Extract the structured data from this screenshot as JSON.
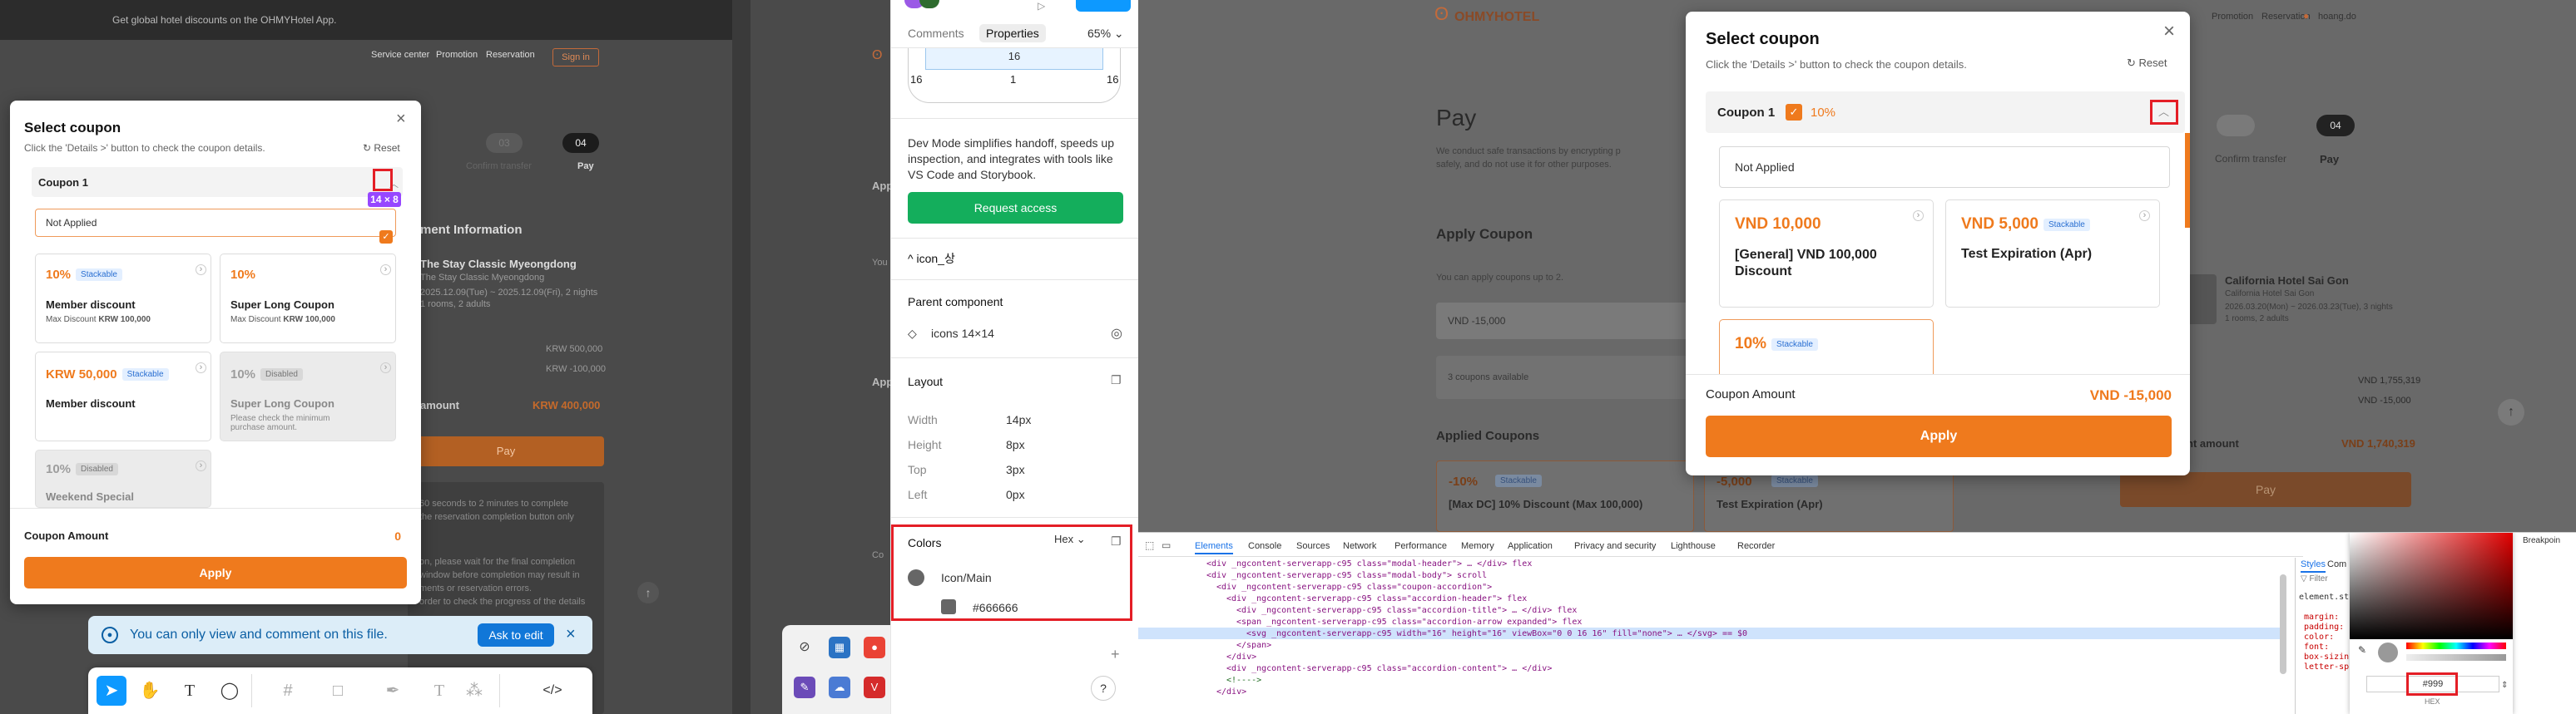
{
  "left_site": {
    "promo_text": "Get global hotel discounts on the OHMYHotel App.",
    "nav": [
      "Service center",
      "Promotion",
      "Reservation"
    ],
    "signin": "Sign in",
    "steps": [
      "03",
      "04"
    ],
    "step_labels": [
      "Confirm transfer",
      "Pay"
    ],
    "payment_info_title": "ment Information",
    "hotel_name": "The Stay Classic Myeongdong",
    "hotel_sub": "The Stay Classic Myeongdong",
    "hotel_dates": "2025.12.09(Tue) ~ 2025.12.09(Fri), 2 nights",
    "hotel_rooms": "1 rooms, 2 adults",
    "price_1": "KRW 500,000",
    "price_2": "KRW -100,000",
    "amount_label": "amount",
    "amount_value": "KRW 400,000",
    "pay_label": "Pay",
    "notice_1": "60 seconds to 2 minutes to complete",
    "notice_2": "the reservation completion button only",
    "notice_3": "on, please wait for the final completion",
    "notice_4": "window before completion may result in",
    "notice_5": "ments or reservation errors.",
    "notice_6": "order to check the progress of the details",
    "side_labels": [
      "App",
      "You",
      "App",
      "Co"
    ]
  },
  "coupon_modal_left": {
    "title": "Select coupon",
    "subtitle": "Click the 'Details >' button to check the coupon details.",
    "reset": "Reset",
    "accordion_title": "Coupon 1",
    "not_applied": "Not Applied",
    "measure_label": "14 × 8",
    "coupons": [
      {
        "value": "10%",
        "badge": "Stackable",
        "name": "Member discount",
        "desc_label": "Max Discount",
        "desc_value": "KRW 100,000",
        "disabled": false
      },
      {
        "value": "10%",
        "badge": "",
        "name": "Super Long Coupon",
        "desc_label": "Max Discount",
        "desc_value": "KRW 100,000",
        "disabled": false
      },
      {
        "value": "KRW 50,000",
        "badge": "Stackable",
        "name": "Member discount",
        "desc_label": "",
        "desc_value": "",
        "disabled": false
      },
      {
        "value": "10%",
        "badge": "Disabled",
        "name": "Super Long Coupon",
        "desc_label": "Please check the minimum purchase amount.",
        "desc_value": "",
        "disabled": true
      },
      {
        "value": "10%",
        "badge": "Disabled",
        "name": "Weekend Special",
        "desc_label": "",
        "desc_value": "",
        "disabled": true
      }
    ],
    "amount_label": "Coupon Amount",
    "amount_value": "0",
    "apply": "Apply"
  },
  "toast": {
    "text": "You can only view and comment on this file.",
    "button": "Ask to edit"
  },
  "toolbar": {
    "tools": [
      "move-tool-icon",
      "hand-tool-icon",
      "text-tool-icon",
      "comment-tool-icon",
      "frame-tool-icon",
      "shape-tool-icon",
      "pen-tool-icon",
      "text-tool-2-icon",
      "components-icon",
      "dev-mode-icon"
    ]
  },
  "dev_panel": {
    "tabs": [
      "Comments",
      "Properties"
    ],
    "zoom": "65%",
    "box_values": {
      "top": "16",
      "left": "16",
      "center": "1",
      "right": "16"
    },
    "description": "Dev Mode simplifies handoff, speeds up inspection, and integrates with tools like VS Code and Storybook.",
    "request_access": "Request access",
    "layer_name": "icon_상",
    "parent_component_label": "Parent component",
    "parent_component": "icons 14×14",
    "layout_label": "Layout",
    "layout": [
      {
        "label": "Width",
        "value": "14px"
      },
      {
        "label": "Height",
        "value": "8px"
      },
      {
        "label": "Top",
        "value": "3px"
      },
      {
        "label": "Left",
        "value": "0px"
      }
    ],
    "colors_label": "Colors",
    "color_format": "Hex",
    "color_name": "Icon/Main",
    "color_hex": "#666666"
  },
  "right_site": {
    "logo": "OHMYHOTEL",
    "nav": [
      "Promotion",
      "Reservation",
      "hoang.do"
    ],
    "page_title": "Pay",
    "page_desc_1": "We conduct safe transactions by encrypting p",
    "page_desc_2": "safely, and do not use it for other purposes.",
    "apply_coupon": "Apply Coupon",
    "coupons_up_to": "You can apply coupons up to 2.",
    "coupon_value_field": "VND -15,000",
    "coupons_available": "3 coupons available",
    "applied_coupons": "Applied Coupons",
    "applied_1_value": "-10%",
    "applied_1_badge": "Stackable",
    "applied_1_name": "[Max DC] 10% Discount (Max 100,000)",
    "applied_2_value": "-5,000",
    "applied_2_badge": "Stackable",
    "applied_2_name": "Test Expiration (Apr)",
    "step_labels": [
      "Confirm transfer",
      "Pay"
    ],
    "step_num": "04",
    "hotel_name": "California Hotel Sai Gon",
    "hotel_sub": "California Hotel Sai Gon",
    "hotel_dates": "2026.03.20(Mon) ~ 2026.03.23(Tue), 3 nights",
    "hotel_rooms": "1 rooms, 2 adults",
    "price_1": "VND 1,755,319",
    "price_2": "VND -15,000",
    "total_label": "nt amount",
    "total_value": "VND 1,740,319",
    "pay": "Pay"
  },
  "coupon_modal_right": {
    "title": "Select coupon",
    "subtitle": "Click the 'Details >' button to check the coupon details.",
    "reset": "Reset",
    "accordion_title": "Coupon 1",
    "accordion_value": "10%",
    "not_applied": "Not Applied",
    "coupons": [
      {
        "value": "VND 10,000",
        "badge": "",
        "name": "[General] VND 100,000 Discount"
      },
      {
        "value": "VND 5,000",
        "badge": "Stackable",
        "name": "Test Expiration (Apr)"
      },
      {
        "value": "10%",
        "badge": "Stackable",
        "name": ""
      }
    ],
    "amount_label": "Coupon Amount",
    "amount_value": "VND -15,000",
    "apply": "Apply"
  },
  "devtools": {
    "tabs": [
      "Elements",
      "Console",
      "Sources",
      "Network",
      "Performance",
      "Memory",
      "Application",
      "Privacy and security",
      "Lighthouse",
      "Recorder"
    ],
    "lines": [
      "<div _ngcontent-serverapp-c95 class=\"modal-header\"> … </div> flex",
      "<div _ngcontent-serverapp-c95 class=\"modal-body\"> scroll",
      "<div _ngcontent-serverapp-c95 class=\"coupon-accordion\">",
      "<div _ngcontent-serverapp-c95 class=\"accordion-header\"> flex",
      "<div _ngcontent-serverapp-c95 class=\"accordion-title\"> … </div> flex",
      "<span _ngcontent-serverapp-c95 class=\"accordion-arrow expanded\"> flex",
      "<svg _ngcontent-serverapp-c95 width=\"16\" height=\"16\" viewBox=\"0 0 16 16\" fill=\"none\"> … </svg> == $0",
      "</span>",
      "</div>",
      "<div _ngcontent-serverapp-c95 class=\"accordion-content\"> … </div>",
      "<!---->",
      "</div>"
    ],
    "styles_tabs": [
      "Styles",
      "Com"
    ],
    "filter": "Filter",
    "element_style": "element.style",
    "css_props": [
      "margin:",
      "padding:",
      "color:",
      "font:",
      "box-sizin",
      "letter-sp"
    ],
    "hex_value": "#999",
    "hex_label": "HEX",
    "breakpoints": "Breakpoin"
  },
  "colors": {
    "accent": "#ef7a1d",
    "figma_blue": "#0d99ff",
    "request_green": "#14ae5c",
    "highlight_red": "#e41e26",
    "measure_purple": "#9747ff",
    "icon_main": "#666666"
  }
}
